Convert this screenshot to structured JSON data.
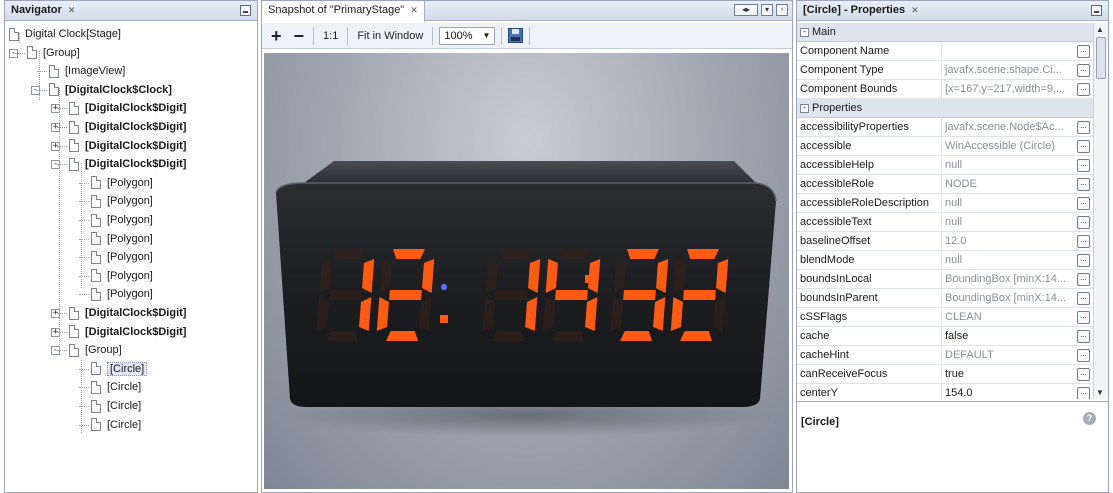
{
  "navigator": {
    "title": "Navigator",
    "close_glyph": "✕",
    "rows": [
      {
        "label": "Digital Clock[Stage]",
        "bold": false
      },
      {
        "label": "[Group]",
        "bold": false
      },
      {
        "label": "[ImageView]",
        "bold": false
      },
      {
        "label": "[DigitalClock$Clock]",
        "bold": true
      },
      {
        "label": "[DigitalClock$Digit]",
        "bold": true
      },
      {
        "label": "[DigitalClock$Digit]",
        "bold": true
      },
      {
        "label": "[DigitalClock$Digit]",
        "bold": true
      },
      {
        "label": "[DigitalClock$Digit]",
        "bold": true
      },
      {
        "label": "[Polygon]",
        "bold": false
      },
      {
        "label": "[Polygon]",
        "bold": false
      },
      {
        "label": "[Polygon]",
        "bold": false
      },
      {
        "label": "[Polygon]",
        "bold": false
      },
      {
        "label": "[Polygon]",
        "bold": false
      },
      {
        "label": "[Polygon]",
        "bold": false
      },
      {
        "label": "[Polygon]",
        "bold": false
      },
      {
        "label": "[DigitalClock$Digit]",
        "bold": true
      },
      {
        "label": "[DigitalClock$Digit]",
        "bold": true
      },
      {
        "label": "[Group]",
        "bold": false
      },
      {
        "label": "[Circle]",
        "bold": false,
        "selected": true
      },
      {
        "label": "[Circle]",
        "bold": false
      },
      {
        "label": "[Circle]",
        "bold": false
      },
      {
        "label": "[Circle]",
        "bold": false
      }
    ]
  },
  "snapshot": {
    "title": "Snapshot of \"PrimaryStage\"",
    "close_glyph": "✕",
    "toolbar": {
      "zoom_in": "+",
      "zoom_out": "−",
      "one_to_one": "1:1",
      "fit_in_window": "Fit in Window",
      "zoom_value": "100%"
    },
    "clock": {
      "hours": "12",
      "minutes": "14",
      "seconds": "32",
      "digit_color": "#ff5a12",
      "dim_color": "#3a2018"
    }
  },
  "properties": {
    "title": "[Circle] - Properties",
    "close_glyph": "✕",
    "categories": [
      {
        "name": "Main",
        "rows": [
          {
            "name": "Component Name",
            "value": "",
            "dark": false
          },
          {
            "name": "Component Type",
            "value": "javafx.scene.shape.Ci...",
            "dark": false
          },
          {
            "name": "Component Bounds",
            "value": "[x=167,y=217,width=9,...",
            "dark": false
          }
        ]
      },
      {
        "name": "Properties",
        "rows": [
          {
            "name": "accessibilityProperties",
            "value": "javafx.scene.Node$Ac...",
            "dark": false
          },
          {
            "name": "accessible",
            "value": "WinAccessible (Circle)",
            "dark": false
          },
          {
            "name": "accessibleHelp",
            "value": "null",
            "dark": false
          },
          {
            "name": "accessibleRole",
            "value": "NODE",
            "dark": false
          },
          {
            "name": "accessibleRoleDescription",
            "value": "null",
            "dark": false
          },
          {
            "name": "accessibleText",
            "value": "null",
            "dark": false
          },
          {
            "name": "baselineOffset",
            "value": "12.0",
            "dark": false
          },
          {
            "name": "blendMode",
            "value": "null",
            "dark": false
          },
          {
            "name": "boundsInLocal",
            "value": "BoundingBox [minX:14...",
            "dark": false
          },
          {
            "name": "boundsInParent",
            "value": "BoundingBox [minX:14...",
            "dark": false
          },
          {
            "name": "cSSFlags",
            "value": "CLEAN",
            "dark": false
          },
          {
            "name": "cache",
            "value": "false",
            "dark": true
          },
          {
            "name": "cacheHint",
            "value": "DEFAULT",
            "dark": false
          },
          {
            "name": "canReceiveFocus",
            "value": "true",
            "dark": true
          },
          {
            "name": "centerY",
            "value": "154.0",
            "dark": true
          }
        ]
      }
    ],
    "description_title": "[Circle]",
    "help_glyph": "?",
    "ellipsis": "..."
  }
}
